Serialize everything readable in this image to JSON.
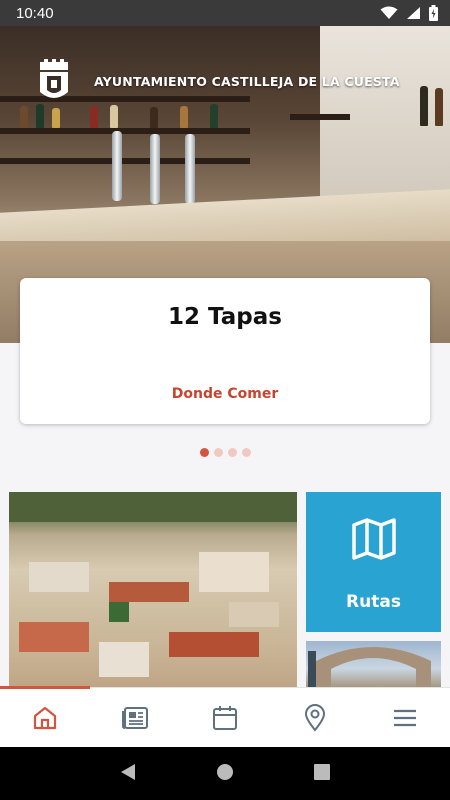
{
  "status_bar": {
    "time": "10:40"
  },
  "hero": {
    "title": "AYUNTAMIENTO CASTILLEJA DE LA CUESTA"
  },
  "featured": {
    "title": "12 Tapas",
    "subtitle": "Donde Comer"
  },
  "carousel": {
    "count": 4,
    "active_index": 0
  },
  "tiles": {
    "rutas_label": "Rutas"
  },
  "bottom_nav": {
    "items": [
      {
        "icon": "home-icon",
        "active": true
      },
      {
        "icon": "news-icon",
        "active": false
      },
      {
        "icon": "calendar-icon",
        "active": false
      },
      {
        "icon": "map-pin-icon",
        "active": false
      },
      {
        "icon": "menu-icon",
        "active": false
      }
    ]
  },
  "colors": {
    "accent": "#d4553f",
    "tile_blue": "#29a3d1",
    "icon_gray": "#5f7180",
    "status_bar": "#3a3a3a"
  }
}
